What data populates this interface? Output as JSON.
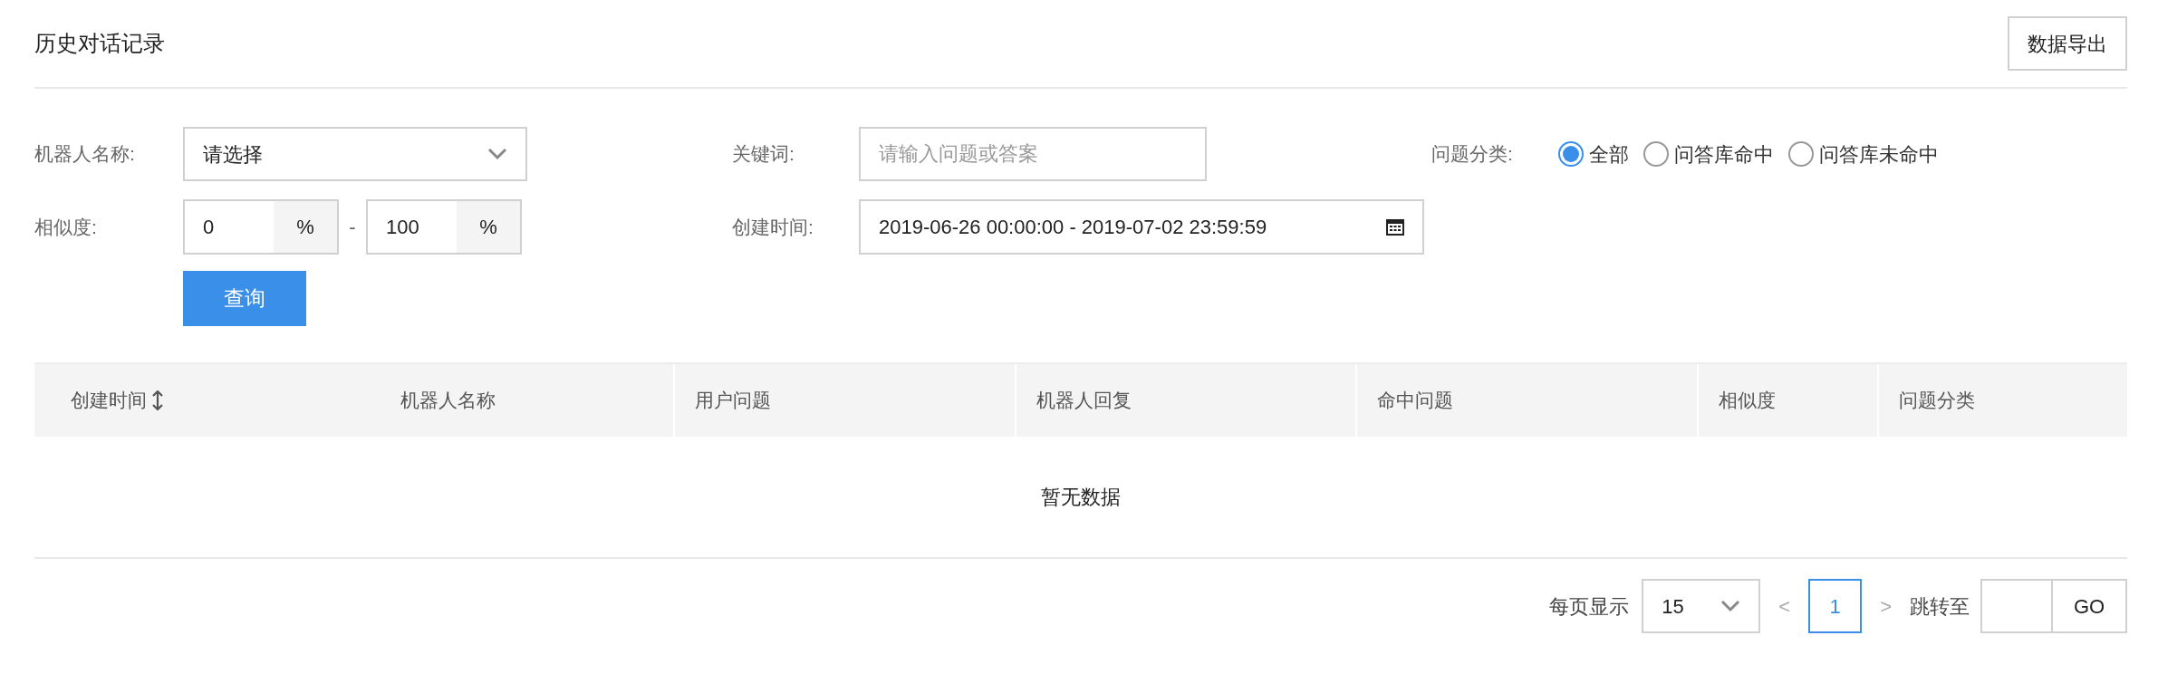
{
  "header": {
    "title": "历史对话记录",
    "export_button": "数据导出"
  },
  "filters": {
    "robot_name": {
      "label": "机器人名称:",
      "placeholder": "请选择"
    },
    "keyword": {
      "label": "关键词:",
      "placeholder": "请输入问题或答案"
    },
    "category": {
      "label": "问题分类:",
      "options": [
        {
          "label": "全部",
          "selected": true
        },
        {
          "label": "问答库命中",
          "selected": false
        },
        {
          "label": "问答库未命中",
          "selected": false
        }
      ]
    },
    "similarity": {
      "label": "相似度:",
      "min": "0",
      "min_unit": "%",
      "separator": "-",
      "max": "100",
      "max_unit": "%"
    },
    "created_time": {
      "label": "创建时间:",
      "value": "2019-06-26 00:00:00 - 2019-07-02 23:59:59"
    },
    "query_button": "查询"
  },
  "table": {
    "columns": [
      {
        "label": "创建时间",
        "sortable": true
      },
      {
        "label": "机器人名称",
        "sortable": false
      },
      {
        "label": "用户问题",
        "sortable": false
      },
      {
        "label": "机器人回复",
        "sortable": false
      },
      {
        "label": "命中问题",
        "sortable": false
      },
      {
        "label": "相似度",
        "sortable": false
      },
      {
        "label": "问题分类",
        "sortable": false
      }
    ],
    "empty_text": "暂无数据"
  },
  "pagination": {
    "page_size_label": "每页显示",
    "page_size": "15",
    "prev": "<",
    "pages": [
      {
        "label": "1",
        "selected": true
      }
    ],
    "next": ">",
    "jump_label": "跳转至",
    "go_button": "GO"
  }
}
